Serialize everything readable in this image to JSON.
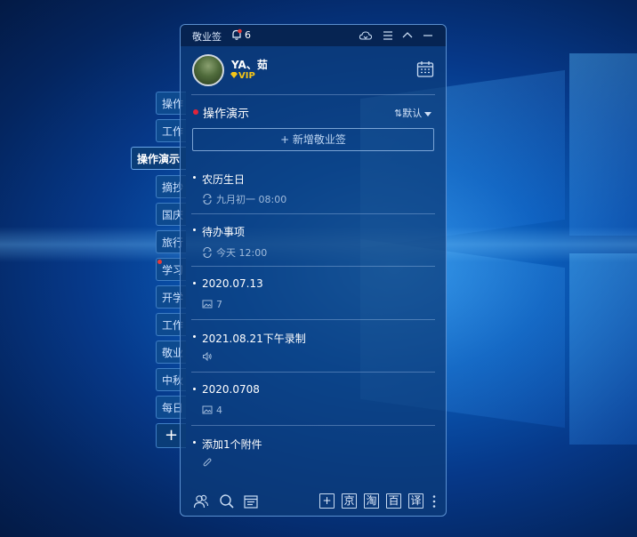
{
  "app": {
    "name": "敬业签",
    "notification_count": "6"
  },
  "user": {
    "name": "YA、茹",
    "badge": "VIP"
  },
  "side_tabs": [
    {
      "label": "操作"
    },
    {
      "label": "工作"
    },
    {
      "label": "操作演示",
      "active": true
    },
    {
      "label": "摘抄"
    },
    {
      "label": "国庆"
    },
    {
      "label": "旅行"
    },
    {
      "label": "学习"
    },
    {
      "label": "开学"
    },
    {
      "label": "工作"
    },
    {
      "label": "敬业"
    },
    {
      "label": "中秋"
    },
    {
      "label": "每日"
    }
  ],
  "side_add": "+",
  "group": {
    "title": "操作演示",
    "sort_label": "默认",
    "sort_prefix": "⇅"
  },
  "new_button": "+ 新增敬业签",
  "items": [
    {
      "title": "农历生日",
      "meta": "九月初一 08:00",
      "meta_icon": "repeat-icon"
    },
    {
      "title": "待办事项",
      "meta": "今天 12:00",
      "meta_icon": "repeat-icon"
    },
    {
      "title": "2020.07.13",
      "meta": "7",
      "meta_icon": "image-icon"
    },
    {
      "title": "2021.08.21下午录制",
      "meta": "",
      "meta_icon": "audio-icon"
    },
    {
      "title": "2020.0708",
      "meta": "4",
      "meta_icon": "image-icon"
    },
    {
      "title": "添加1个附件",
      "meta": "",
      "meta_icon": "attachment-icon"
    }
  ],
  "bottom": {
    "jing": "京",
    "tao": "淘",
    "bai": "百",
    "yi": "译",
    "plus": "+"
  },
  "colors": {
    "panel": "#0c3c78",
    "accent_dot": "#e0243a",
    "vip": "#f5c518"
  }
}
